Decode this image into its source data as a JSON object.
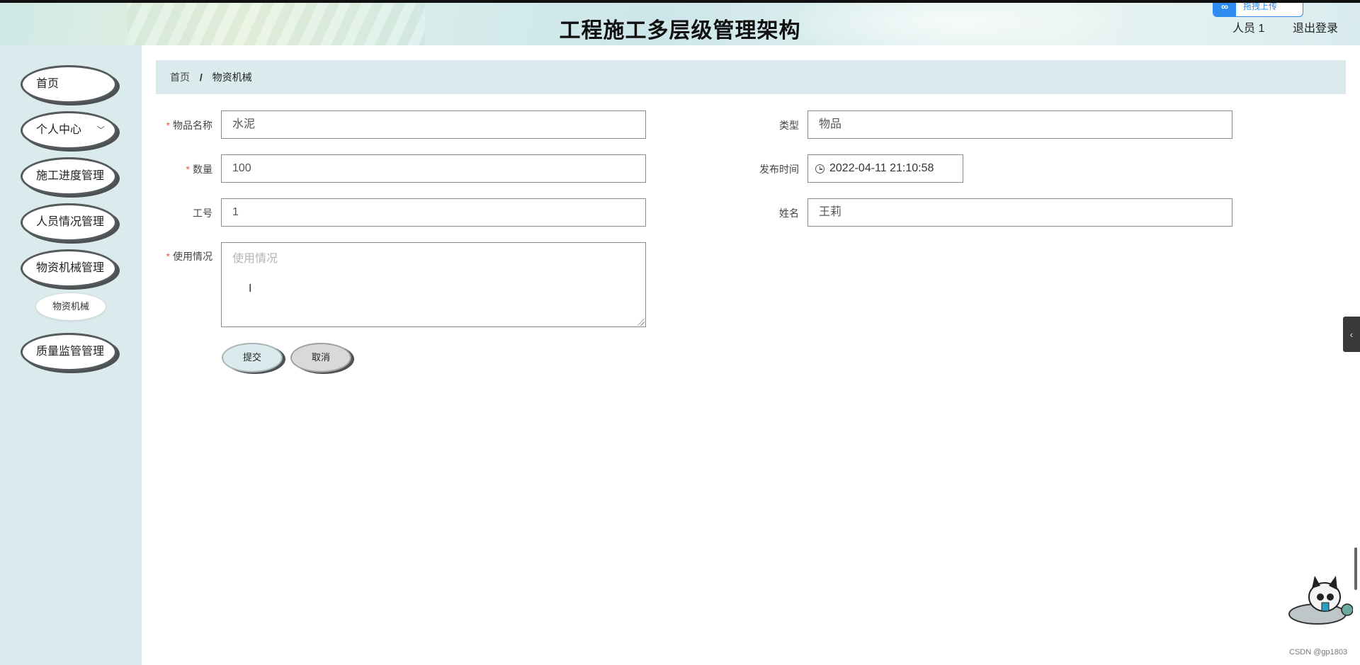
{
  "header": {
    "title": "工程施工多层级管理架构",
    "user": "人员 1",
    "logout": "退出登录",
    "upload_pill": "拖拽上传"
  },
  "sidebar": {
    "items": [
      {
        "label": "首页"
      },
      {
        "label": "个人中心",
        "has_chevron": true
      },
      {
        "label": "施工进度管理"
      },
      {
        "label": "人员情况管理"
      },
      {
        "label": "物资机械管理"
      },
      {
        "label": "质量监管管理"
      }
    ],
    "subitem": {
      "label": "物资机械"
    }
  },
  "breadcrumb": {
    "home": "首页",
    "separator": "/",
    "current": "物资机械"
  },
  "form": {
    "item_name": {
      "label": "物品名称",
      "value": "水泥",
      "required": true
    },
    "type": {
      "label": "类型",
      "value": "物品"
    },
    "quantity": {
      "label": "数量",
      "value": "100",
      "required": true
    },
    "publish_time": {
      "label": "发布时间",
      "value": "2022-04-11 21:10:58"
    },
    "job_no": {
      "label": "工号",
      "value": "1"
    },
    "name": {
      "label": "姓名",
      "value": "王莉"
    },
    "usage": {
      "label": "使用情况",
      "placeholder": "使用情况",
      "required": true
    },
    "submit": "提交",
    "cancel": "取消"
  },
  "watermark": "CSDN @gp1803",
  "colors": {
    "sidebar_bg": "#dbeaec",
    "required_mark": "#e8564a",
    "accent_blue": "#2f8bf0"
  }
}
